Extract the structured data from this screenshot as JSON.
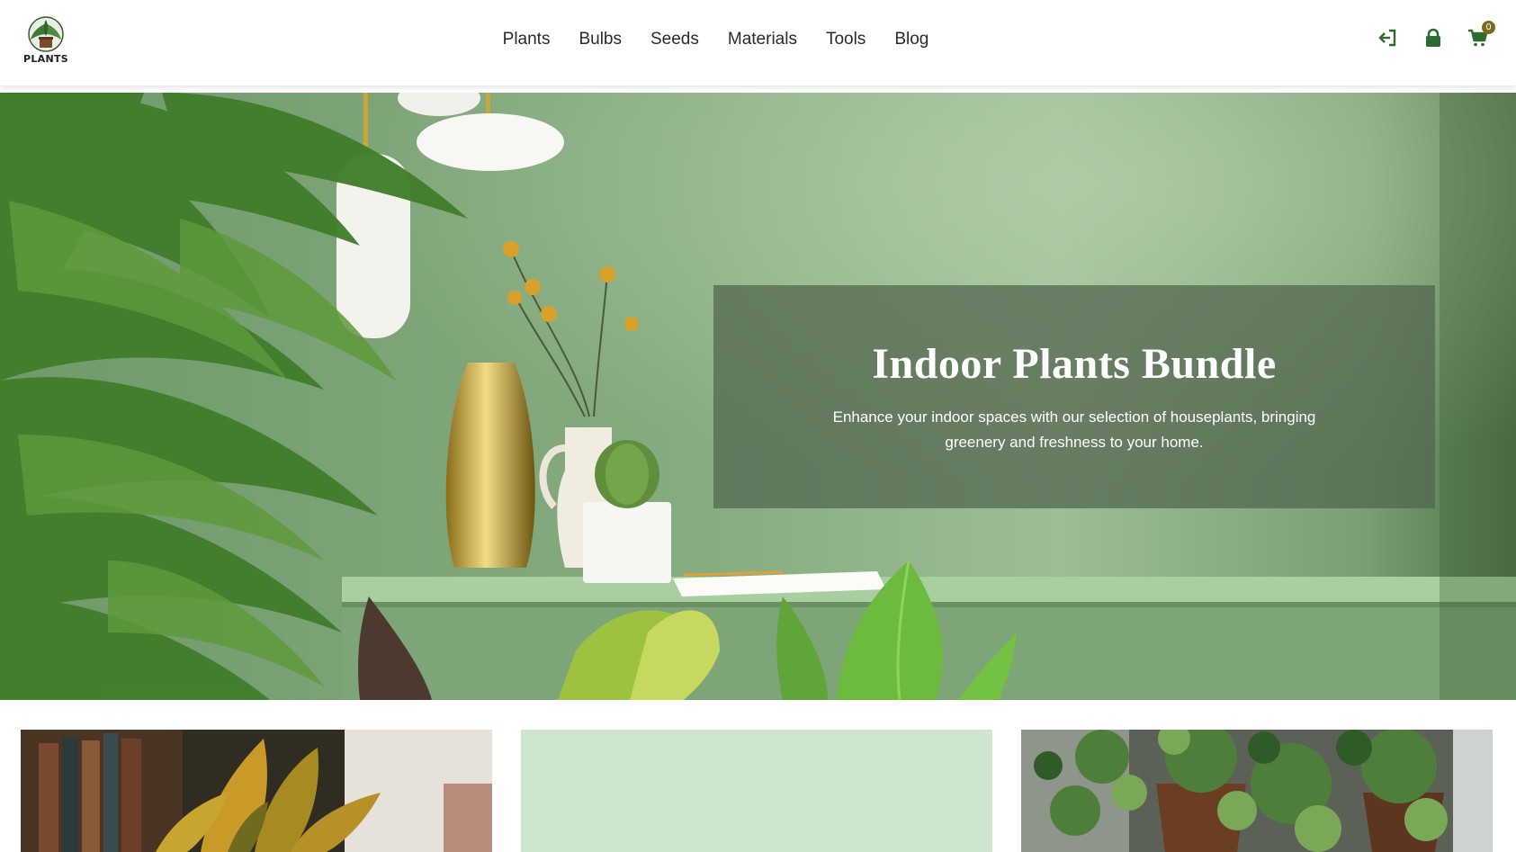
{
  "header": {
    "logo_text": "PLANTS",
    "nav": [
      "Plants",
      "Bulbs",
      "Seeds",
      "Materials",
      "Tools",
      "Blog"
    ],
    "icons": [
      "login-icon",
      "lock-icon",
      "cart-icon"
    ],
    "cart_count": "0"
  },
  "hero": {
    "title": "Indoor Plants Bundle",
    "text": "Enhance your indoor spaces with our selection of houseplants, bringing greenery and freshness to your home."
  },
  "colors": {
    "accent": "#2e6b2e",
    "badge": "#7a6a1a",
    "hero_box": "#50644e",
    "card_mint": "#cfe6ce"
  }
}
